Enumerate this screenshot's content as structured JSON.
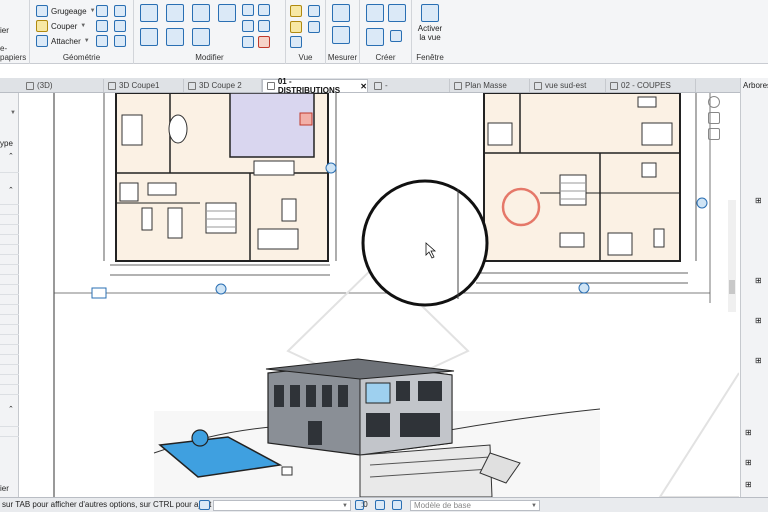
{
  "ribbon": {
    "clipboard": {
      "label": "e-papiers",
      "top_fragment": "ier"
    },
    "geometry": {
      "label": "Géométrie",
      "items": [
        "Grugeage",
        "Couper",
        "Attacher"
      ]
    },
    "modify": {
      "label": "Modifier"
    },
    "view": {
      "label": "Vue"
    },
    "measure": {
      "label": "Mesurer"
    },
    "create": {
      "label": "Créer"
    },
    "window": {
      "label": "Fenêtre",
      "activate_line1": "Activer",
      "activate_line2": "la vue"
    }
  },
  "tabs": [
    {
      "label": "(3D)"
    },
    {
      "label": "3D Coupe1"
    },
    {
      "label": "3D Coupe 2"
    },
    {
      "label": "01 - DISTRIBUTIONS",
      "active": true
    },
    {
      "label": "-"
    },
    {
      "label": "Plan Masse"
    },
    {
      "label": "vue sud-est"
    },
    {
      "label": "02 - COUPES"
    }
  ],
  "left_panel": {
    "type_label": "ype",
    "bottom_label": "ier"
  },
  "right_panel": {
    "title": "Arbores"
  },
  "status": {
    "hint": "sur TAB pour afficher d'autres options, sur CTRL pour ajout",
    "workset_value": ":0",
    "model_placeholder": "Modèle de base"
  },
  "colors": {
    "accent": "#2a6fb3",
    "ribbon_bg": "#f4f5f7",
    "pool": "#3fa0e0",
    "highlight": "#e05a4a"
  }
}
